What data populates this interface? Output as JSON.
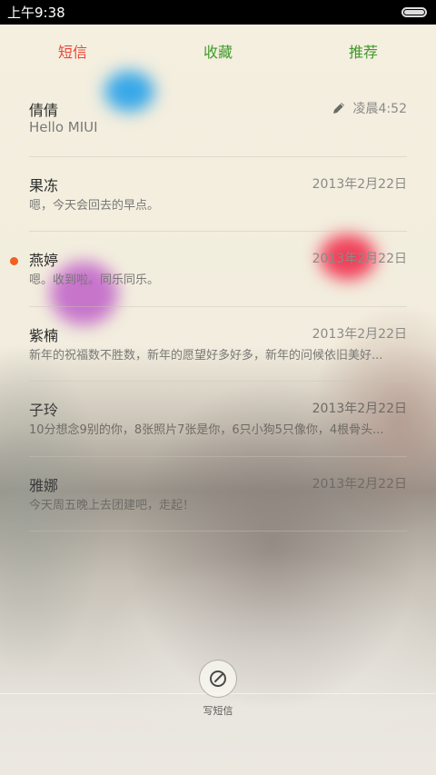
{
  "status_bar": {
    "time": "上午9:38"
  },
  "tabs": [
    {
      "label": "短信",
      "active": true
    },
    {
      "label": "收藏",
      "active": false
    },
    {
      "label": "推荐",
      "active": false
    }
  ],
  "conversations": [
    {
      "name": "倩倩",
      "date": "凌晨4:52",
      "preview": "Hello MIUI",
      "draft": true,
      "unread": false
    },
    {
      "name": "果冻",
      "date": "2013年2月22日",
      "preview": "嗯，今天会回去的早点。",
      "draft": false,
      "unread": false
    },
    {
      "name": "燕婷",
      "date": "2013年2月22日",
      "preview": "嗯。收到啦。同乐同乐。",
      "draft": false,
      "unread": true
    },
    {
      "name": "紫楠",
      "date": "2013年2月22日",
      "preview": "新年的祝福数不胜数，新年的愿望好多好多，新年的问候依旧美好...",
      "draft": false,
      "unread": false
    },
    {
      "name": "子玲",
      "date": "2013年2月22日",
      "preview": "10分想念9别的你，8张照片7张是你，6只小狗5只像你，4根骨头...",
      "draft": false,
      "unread": false
    },
    {
      "name": "雅娜",
      "date": "2013年2月22日",
      "preview": "今天周五晚上去团建吧，走起！",
      "draft": false,
      "unread": false
    }
  ],
  "compose": {
    "label": "写短信",
    "icon": "compose-icon"
  },
  "colors": {
    "tab_active": "#e8473a",
    "tab_inactive": "#3f9a2a",
    "unread_dot": "#f06020"
  }
}
